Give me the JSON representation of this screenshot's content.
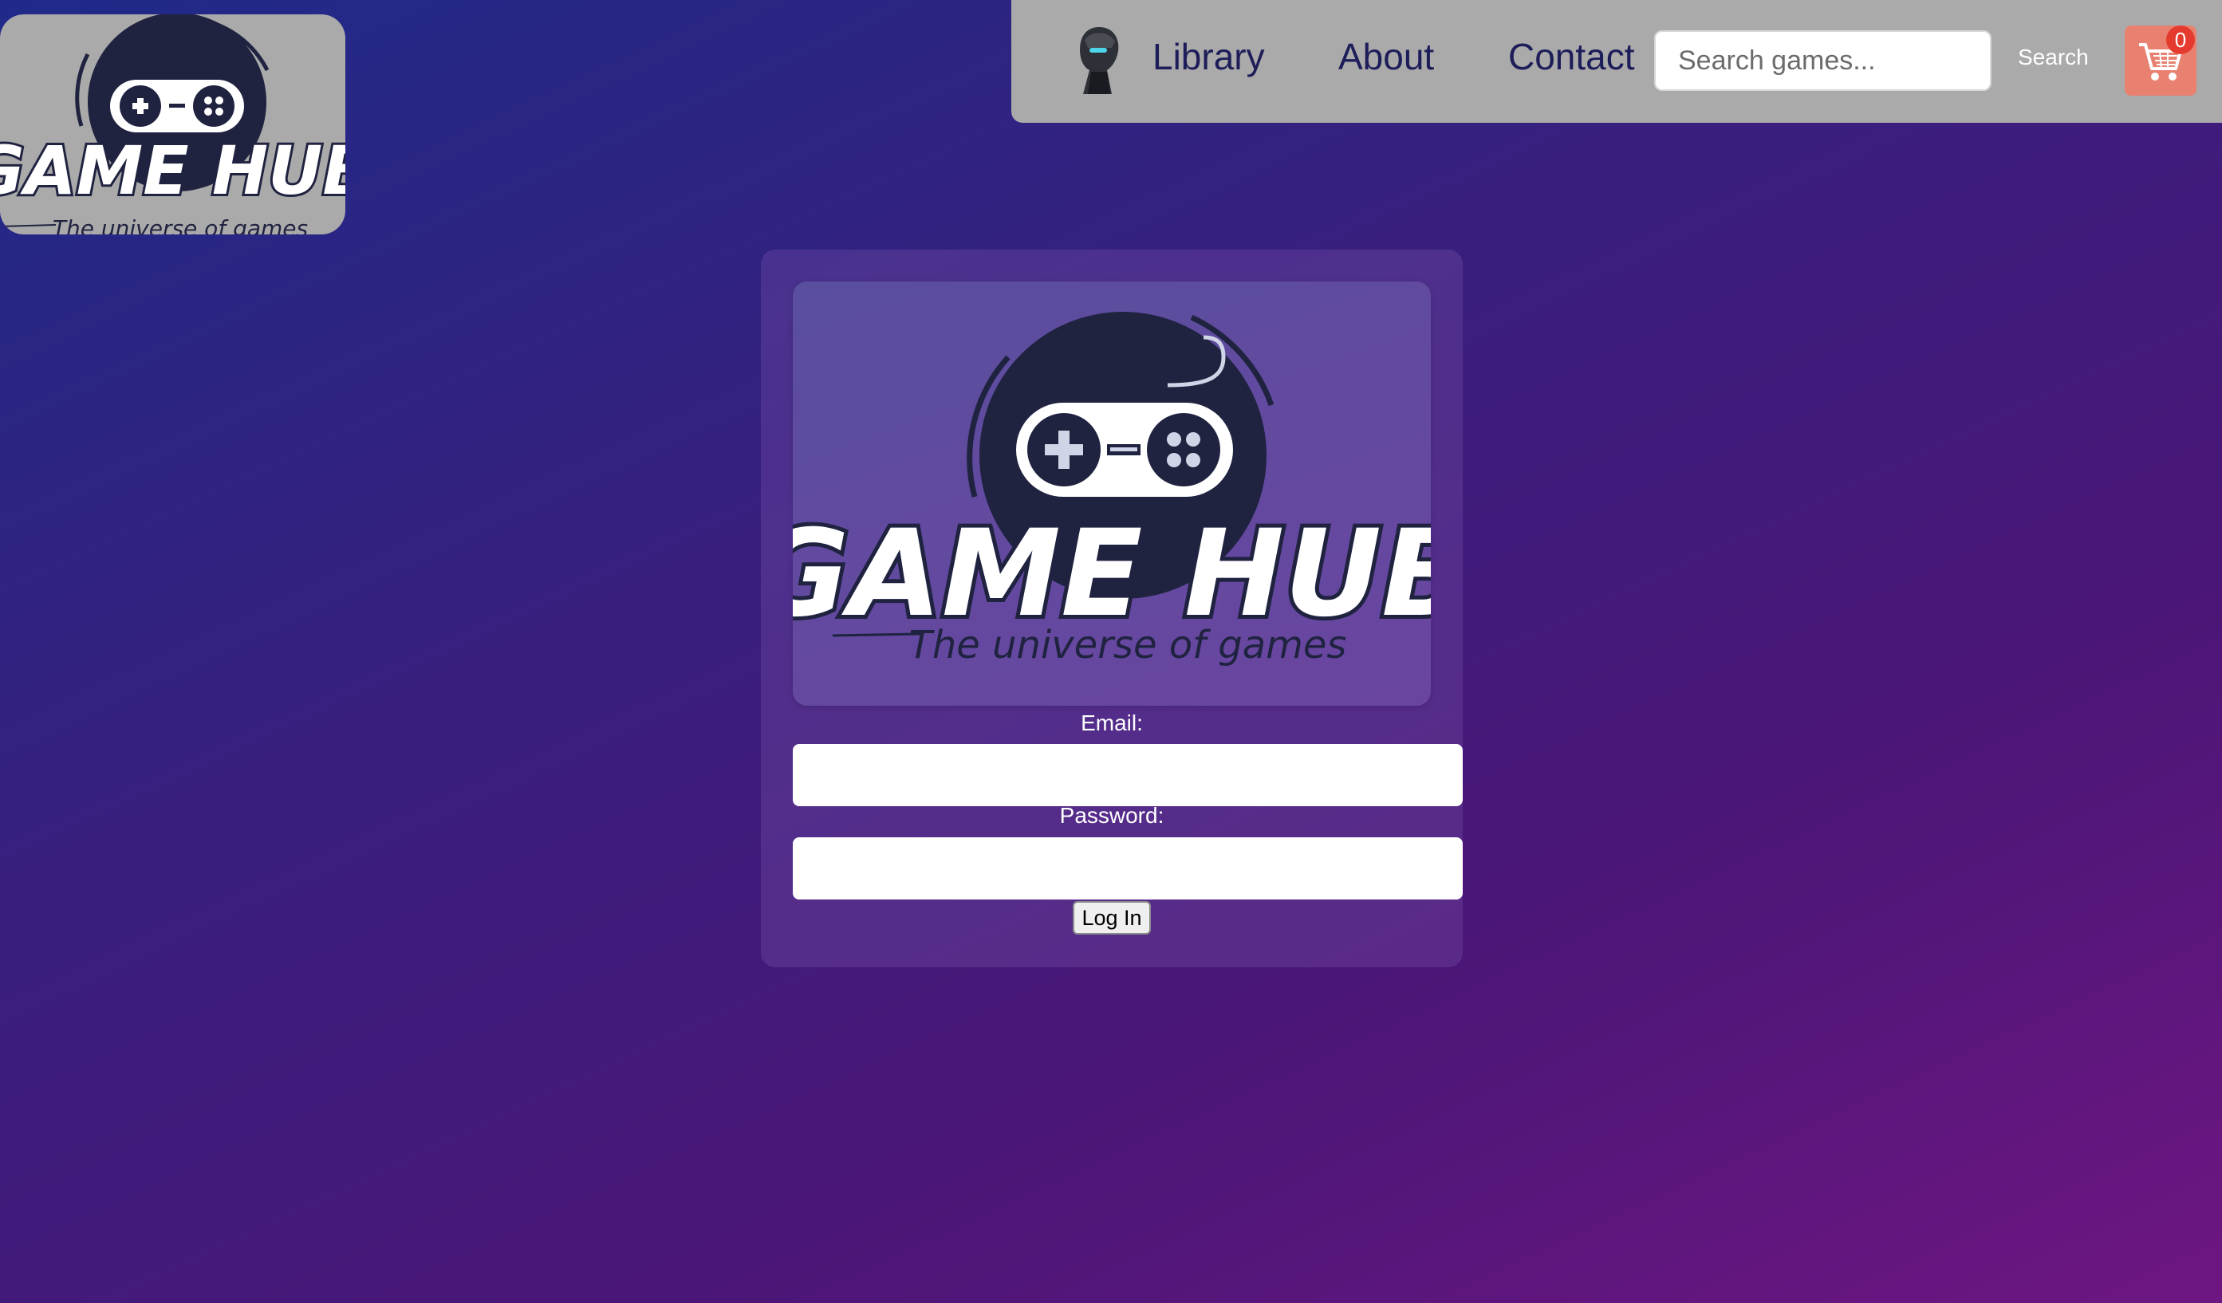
{
  "brand": {
    "logo_title": "GAME HUB",
    "tagline": "The universe of games"
  },
  "nav": {
    "links": [
      {
        "label": "Library"
      },
      {
        "label": "About"
      },
      {
        "label": "Contact"
      }
    ],
    "search_placeholder": "Search games...",
    "search_value": "",
    "search_button": "Search",
    "cart_count": "0"
  },
  "login": {
    "email_label": "Email:",
    "email_value": "",
    "password_label": "Password:",
    "password_value": "",
    "submit_label": "Log In"
  },
  "colors": {
    "bg_start": "#1f2a88",
    "bg_end": "#6e1682",
    "navbar": "#aaaaaa",
    "cart_button": "#e8816f",
    "badge": "#e53a2e",
    "logo_dark": "#1f2340"
  },
  "icons": [
    "gamepad-icon",
    "cart-icon",
    "avatar-icon"
  ]
}
